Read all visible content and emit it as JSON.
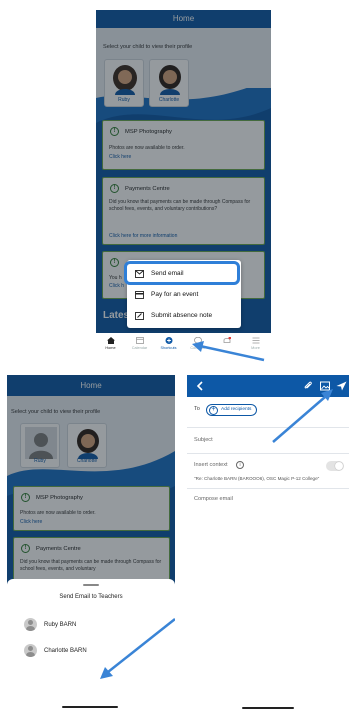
{
  "screen_a": {
    "header_title": "Home",
    "prompt": "Select your child to view their profile",
    "children": [
      {
        "name": "Ruby"
      },
      {
        "name": "Charlotte"
      }
    ],
    "notices": [
      {
        "title": "MSP Photography",
        "body": "Photos are now available to order.",
        "link": "Click here"
      },
      {
        "title": "Payments Centre",
        "body": "Did you know that payments can be made through Compass for school fees, events, and voluntary contributions?",
        "link": "Click here for more information"
      },
      {
        "title": "",
        "body": "You h",
        "link": "Click h"
      }
    ],
    "latest_label": "Lates",
    "menu": [
      {
        "label": "Send email",
        "icon": "envelope-icon"
      },
      {
        "label": "Pay for an event",
        "icon": "card-icon"
      },
      {
        "label": "Submit absence note",
        "icon": "edit-note-icon"
      }
    ],
    "tabs": [
      {
        "label": "Home",
        "icon": "home-icon"
      },
      {
        "label": "Calendar",
        "icon": "calendar-icon"
      },
      {
        "label": "Shortcuts",
        "icon": "plus-circle-icon"
      },
      {
        "label": "Connect",
        "icon": "chat-icon"
      },
      {
        "label": "",
        "icon": "bell-icon"
      },
      {
        "label": "More",
        "icon": "menu-icon"
      }
    ]
  },
  "screen_b": {
    "header_title": "Home",
    "prompt": "Select your child to view their profile",
    "children": [
      {
        "name": "Ruby"
      },
      {
        "name": "Charlotte"
      }
    ],
    "notices": [
      {
        "title": "MSP Photography",
        "body": "Photos are now available to order.",
        "link": "Click here"
      },
      {
        "title": "Payments Centre",
        "body": "Did you know that payments can be made through Compass for school fees, events, and voluntary",
        "link": ""
      }
    ],
    "sheet_title": "Send Email to Teachers",
    "recipients": [
      {
        "name": "Ruby BARN"
      },
      {
        "name": "Charlotte BARN"
      }
    ]
  },
  "screen_c": {
    "to_label": "To",
    "add_recipients": "Add recipients",
    "subject_placeholder": "Subject",
    "insert_context_label": "Insert context",
    "context_text": "\"Re: Charlotte BARN (BAROOO6), OSC Magic P-12 College\"",
    "compose_placeholder": "Compose email"
  },
  "colors": {
    "brand": "#0d58a6",
    "highlight": "#2f7fd8",
    "notice_border": "#6aa84f",
    "arrow": "#3a84d6"
  }
}
